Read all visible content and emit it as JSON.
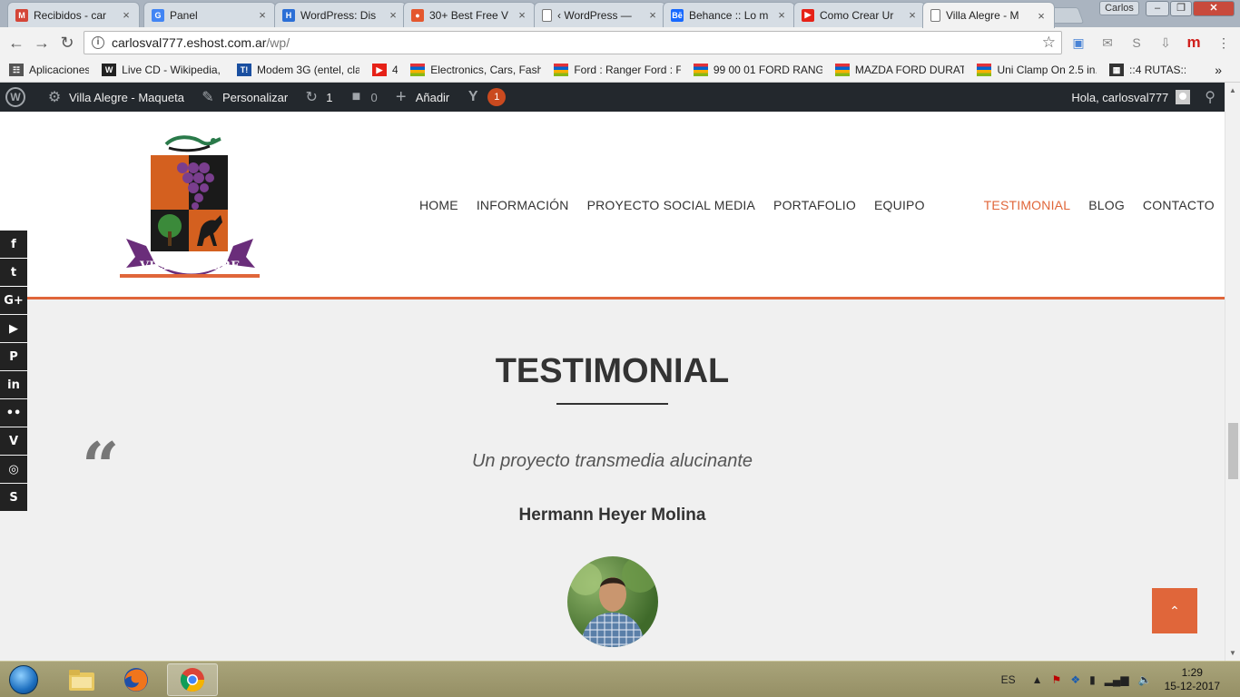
{
  "browser": {
    "tabs": [
      {
        "title": "Recibidos - car",
        "icon": "gmail-icon",
        "color": "#d44638",
        "glyph": "M"
      },
      {
        "title": "Panel",
        "icon": "google-icon",
        "color": "#4285f4",
        "glyph": "G"
      },
      {
        "title": "WordPress: Dis",
        "icon": "wordpress-icon",
        "color": "#2b6fd6",
        "glyph": "H"
      },
      {
        "title": "30+ Best Free V",
        "icon": "colorful-icon",
        "color": "#e4572e",
        "glyph": "●"
      },
      {
        "title": "‹ WordPress —",
        "icon": "page-icon",
        "color": "#ffffff",
        "glyph": ""
      },
      {
        "title": "Behance :: Lo m",
        "icon": "behance-icon",
        "color": "#1769ff",
        "glyph": "Bē"
      },
      {
        "title": "Como Crear Ur",
        "icon": "youtube-icon",
        "color": "#e62117",
        "glyph": "▶"
      },
      {
        "title": "Villa Alegre - M",
        "icon": "page-icon",
        "color": "#ffffff",
        "glyph": ""
      }
    ],
    "profile": "Carlos",
    "url_host": "carlosval777.eshost.com.ar",
    "url_path": "/wp/",
    "bookmarks": [
      {
        "label": "Aplicaciones",
        "icon": "apps-grid-icon"
      },
      {
        "label": "Live CD - Wikipedia, l",
        "icon": "wikipedia-icon"
      },
      {
        "label": "Modem 3G (entel, cla",
        "icon": "t-icon"
      },
      {
        "label": "4",
        "icon": "youtube-icon"
      },
      {
        "label": "Electronics, Cars, Fash",
        "icon": "ebay-icon"
      },
      {
        "label": "Ford : Ranger Ford : F",
        "icon": "ebay-icon"
      },
      {
        "label": "99 00 01 FORD RANG",
        "icon": "ebay-icon"
      },
      {
        "label": "MAZDA FORD DURAT",
        "icon": "ebay-icon"
      },
      {
        "label": "Uni Clamp On 2.5 in.",
        "icon": "ebay-icon"
      },
      {
        "label": "::4 RUTAS::",
        "icon": "site-icon"
      }
    ],
    "bookmarks_more": "»"
  },
  "adminbar": {
    "site_name": "Villa Alegre - Maqueta",
    "customize": "Personalizar",
    "updates_count": "1",
    "comments_count": "0",
    "add_new": "Añadir",
    "yoast_badge": "1",
    "greeting": "Hola, carlosval777"
  },
  "site": {
    "logo_text": "VILLA ALEGRE",
    "nav": [
      "HOME",
      "INFORMACIÓN",
      "PROYECTO SOCIAL MEDIA",
      "PORTAFOLIO",
      "EQUIPO",
      "TESTIMONIAL",
      "BLOG",
      "CONTACTO"
    ],
    "active_nav": "TESTIMONIAL",
    "accent_color": "#e0663a",
    "social": [
      {
        "name": "facebook-icon",
        "glyph": "f"
      },
      {
        "name": "twitter-icon",
        "glyph": "t"
      },
      {
        "name": "google-plus-icon",
        "glyph": "G+"
      },
      {
        "name": "youtube-icon",
        "glyph": "▶"
      },
      {
        "name": "pinterest-icon",
        "glyph": "P"
      },
      {
        "name": "linkedin-icon",
        "glyph": "in"
      },
      {
        "name": "flickr-icon",
        "glyph": "••"
      },
      {
        "name": "vimeo-icon",
        "glyph": "V"
      },
      {
        "name": "instagram-icon",
        "glyph": "◎"
      },
      {
        "name": "skype-icon",
        "glyph": "S"
      }
    ]
  },
  "testimonial": {
    "title": "TESTIMONIAL",
    "quote": "Un proyecto transmedia alucinante",
    "author": "Hermann Heyer Molina"
  },
  "taskbar": {
    "apps": [
      {
        "name": "explorer-icon"
      },
      {
        "name": "firefox-icon"
      },
      {
        "name": "chrome-icon"
      }
    ],
    "language": "ES",
    "time": "1:29",
    "date": "15-12-2017"
  }
}
